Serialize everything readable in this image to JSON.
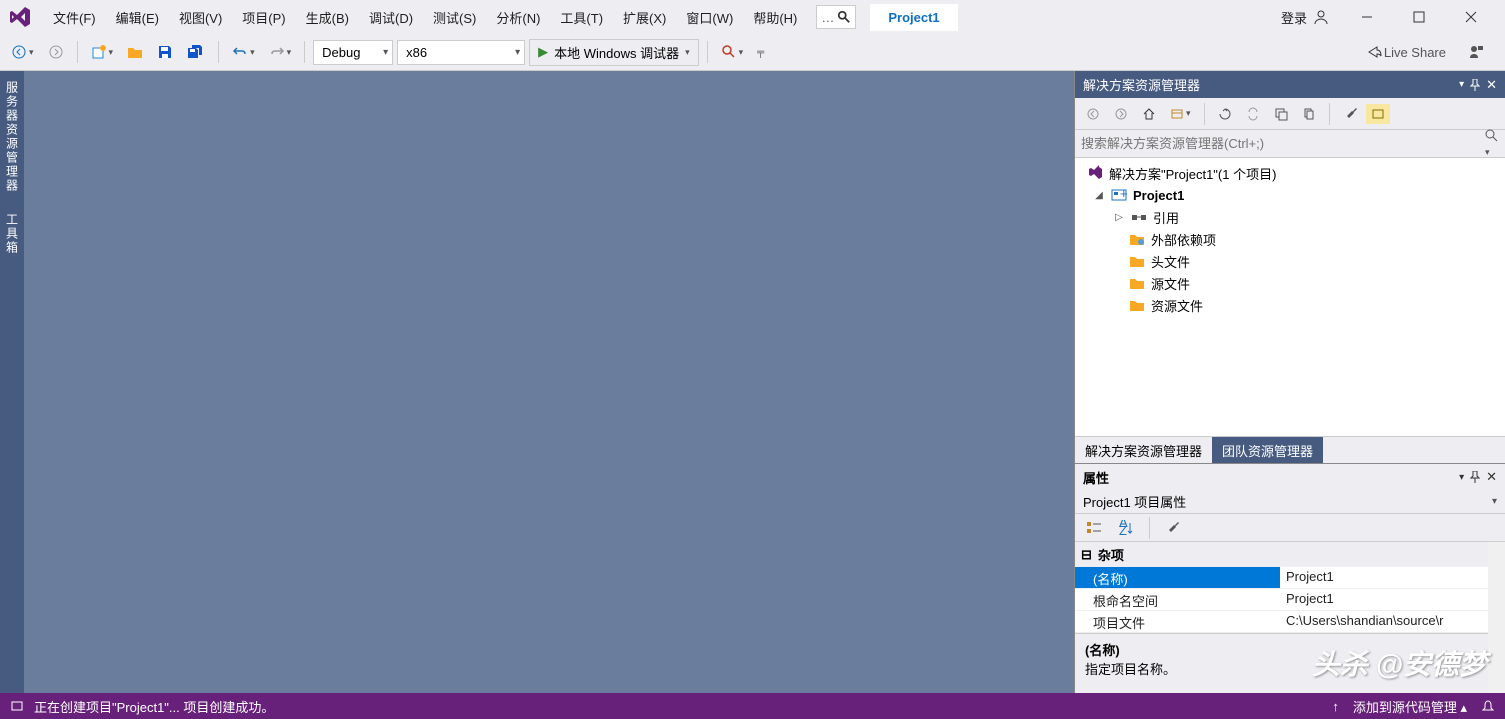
{
  "menubar": {
    "items": [
      "文件(F)",
      "编辑(E)",
      "视图(V)",
      "项目(P)",
      "生成(B)",
      "调试(D)",
      "测试(S)",
      "分析(N)",
      "工具(T)",
      "扩展(X)",
      "窗口(W)",
      "帮助(H)"
    ]
  },
  "title_tab": "Project1",
  "login_label": "登录",
  "toolbar": {
    "config": "Debug",
    "platform": "x86",
    "debug_target": "本地 Windows 调试器",
    "live_share": "Live Share"
  },
  "left_dock": {
    "server_explorer": "服务器资源管理器",
    "toolbox": "工具箱"
  },
  "solution_explorer": {
    "title": "解决方案资源管理器",
    "search_placeholder": "搜索解决方案资源管理器(Ctrl+;)",
    "solution_label": "解决方案\"Project1\"(1 个项目)",
    "project": "Project1",
    "nodes": {
      "references": "引用",
      "external_deps": "外部依赖项",
      "headers": "头文件",
      "sources": "源文件",
      "resources": "资源文件"
    },
    "tabs": {
      "solution": "解决方案资源管理器",
      "team": "团队资源管理器"
    }
  },
  "properties": {
    "title": "属性",
    "subtitle": "Project1 项目属性",
    "category": "杂项",
    "rows": {
      "name_k": "(名称)",
      "name_v": "Project1",
      "root_k": "根命名空间",
      "root_v": "Project1",
      "file_k": "项目文件",
      "file_v": "C:\\Users\\shandian\\source\\r"
    },
    "desc_name": "(名称)",
    "desc_text": "指定项目名称。"
  },
  "status": {
    "message": "正在创建项目\"Project1\"...  项目创建成功。",
    "add_scm": "添加到源代码管理"
  },
  "watermark": "头杀 @安德梦"
}
